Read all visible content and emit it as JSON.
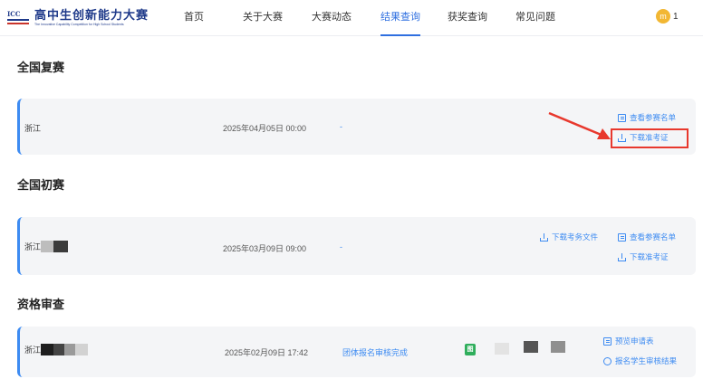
{
  "brand": {
    "mark": "ICC",
    "name_cn": "高中生创新能力大赛",
    "name_en": "The Innovative Capability Competition for High School Students"
  },
  "nav": {
    "items": [
      "首页",
      "关于大赛",
      "大赛动态",
      "结果查询",
      "获奖查询",
      "常见问题"
    ],
    "active": "结果查询"
  },
  "user": {
    "avatar_letter": "m",
    "count": "1"
  },
  "sections": {
    "final": {
      "title": "全国复赛",
      "province": "浙江",
      "date": "2025年04月05日 00:00",
      "status": "-",
      "links": {
        "view_list": "查看参赛名单",
        "download_ticket": "下载准考证"
      }
    },
    "preliminary": {
      "title": "全国初赛",
      "province": "浙江",
      "date": "2025年03月09日 09:00",
      "status": "-",
      "links": {
        "download_exam_file": "下载考务文件",
        "view_list": "查看参赛名单",
        "download_ticket": "下载准考证"
      }
    },
    "qualification": {
      "title": "资格审查",
      "province": "浙江",
      "date": "2025年02月09日 17:42",
      "status": "团体报名审核完成",
      "doc_icon_label": "图",
      "links": {
        "preview_form": "预览申请表",
        "review_result": "报名学生审核结果"
      }
    }
  },
  "colors": {
    "accent": "#3d8bf2",
    "highlight": "#e8382d",
    "card_bg": "#f4f5f7"
  }
}
